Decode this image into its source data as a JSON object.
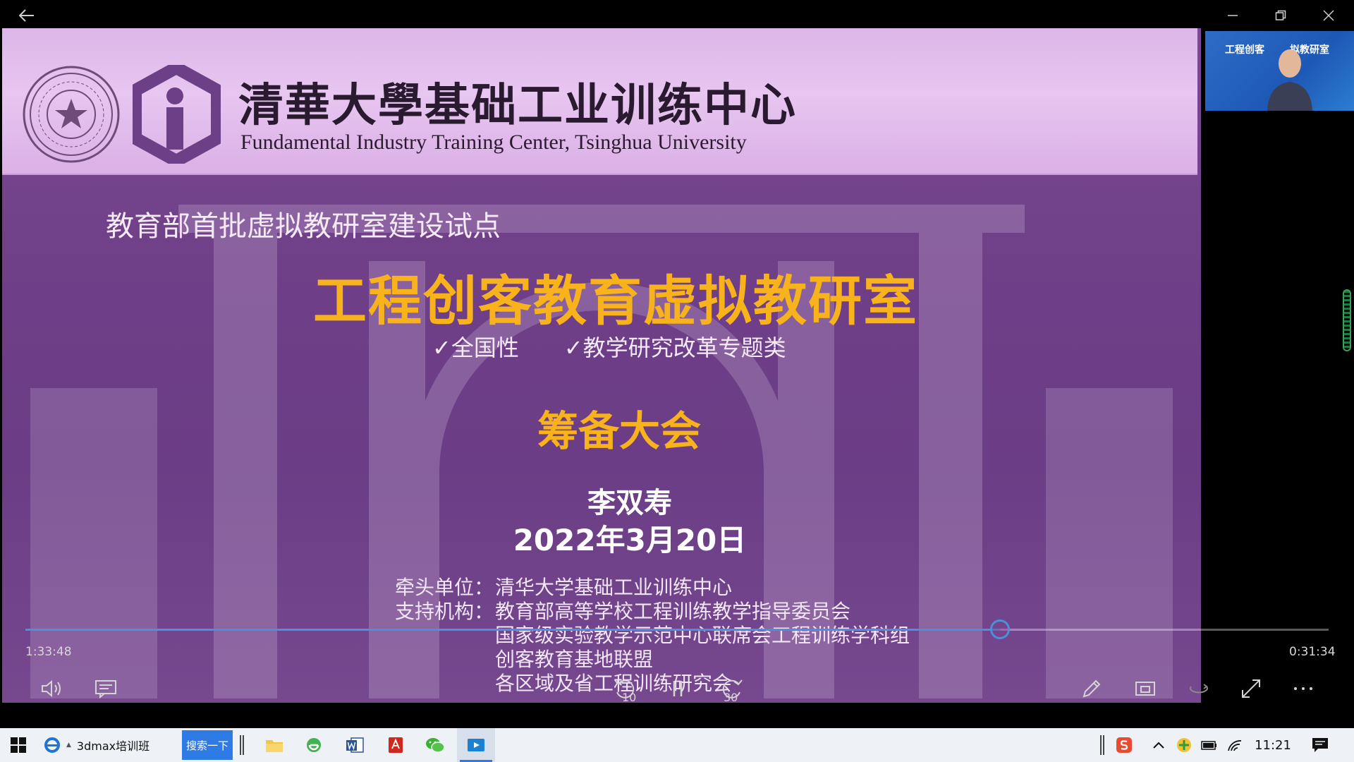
{
  "window": {
    "back_icon": "back-arrow-icon",
    "controls": [
      "minimize-icon",
      "restore-icon",
      "close-icon"
    ]
  },
  "slide": {
    "header": {
      "center_name_cn": "清華大學基础工业训练中心",
      "center_name_en": "Fundamental Industry Training Center, Tsinghua University"
    },
    "pilot_line": "教育部首批虚拟教研室建设试点",
    "main_title": "工程创客教育虚拟教研室",
    "tags": [
      "✓全国性",
      "✓教学研究改革专题类"
    ],
    "subtitle": "筹备大会",
    "speaker": "李双寿",
    "date": "2022年3月20日",
    "organizers": {
      "lead_label": "牵头单位：",
      "lead_value": "清华大学基础工业训练中心",
      "support_label": "支持机构：",
      "support_values": [
        "教育部高等学校工程训练教学指导委员会",
        "国家级实验教学示范中心联席会工程训练学科组",
        "创客教育基地联盟",
        "各区域及省工程训练研究会"
      ]
    }
  },
  "player": {
    "time_elapsed": "1:33:48",
    "time_remaining": "0:31:34",
    "progress": 0.748,
    "skip_back_seconds": "10",
    "skip_forward_seconds": "30",
    "accent_color": "#4d8fd8"
  },
  "pip": {
    "text_left": "工程创客",
    "text_right": "拟教研室"
  },
  "taskbar": {
    "ie_tab_label": "3dmax培训班",
    "search_button": "搜索一下",
    "clock": "11:21"
  }
}
